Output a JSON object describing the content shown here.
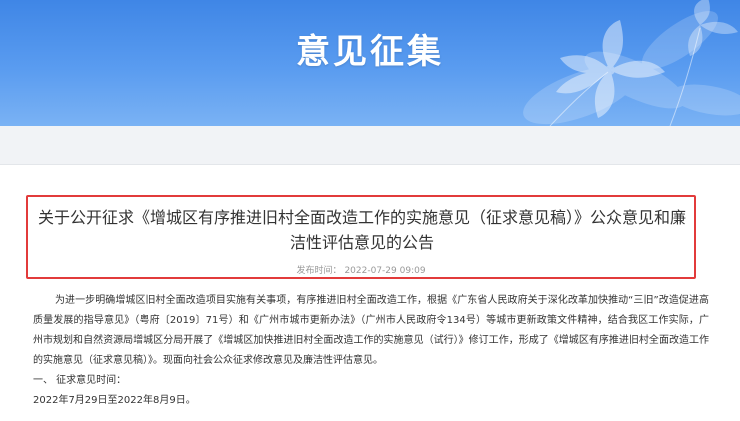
{
  "banner": {
    "title": "意见征集",
    "bg_color": "#4a8fea",
    "decoration": "flower-illustration"
  },
  "article": {
    "title": "关于公开征求《增城区有序推进旧村全面改造工作的实施意见（征求意见稿）》公众意见和廉洁性评估意见的公告",
    "publish_label": "发布时间：",
    "publish_time": "2022-07-29 09:09",
    "highlight_color": "#e23b3b",
    "paragraph_1": "为进一步明确增城区旧村全面改造项目实施有关事项，有序推进旧村全面改造工作，根据《广东省人民政府关于深化改革加快推动“三旧”改造促进高质量发展的指导意见》（粤府〔2019〕71号）和《广州市城市更新办法》（广州市人民政府令134号）等城市更新政策文件精神，结合我区工作实际，广州市规划和自然资源局增城区分局开展了《增城区加快推进旧村全面改造工作的实施意见（试行）》修订工作，形成了《增城区有序推进旧村全面改造工作的实施意见（征求意见稿）》。现面向社会公众征求修改意见及廉洁性评估意见。",
    "section_1_heading": "一、 征求意见时间：",
    "section_1_value": "2022年7月29日至2022年8月9日。"
  }
}
